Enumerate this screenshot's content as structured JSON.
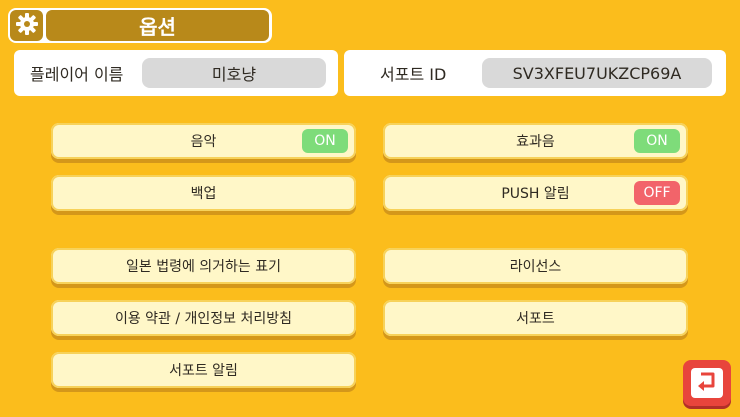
{
  "header": {
    "title": "옵션",
    "settings_icon": "gear-icon"
  },
  "info": {
    "player_name_label": "플레이어 이름",
    "player_name_value": "미호냥",
    "support_id_label": "서포트 ID",
    "support_id_value": "SV3XFEU7UKZCP69A"
  },
  "options": {
    "music": {
      "label": "음악",
      "state": "ON"
    },
    "sound_effects": {
      "label": "효과음",
      "state": "ON"
    },
    "backup": {
      "label": "백업"
    },
    "push": {
      "label": "PUSH 알림",
      "state": "OFF"
    },
    "legal_notice": {
      "label": "일본 법령에 의거하는 표기"
    },
    "license": {
      "label": "라이선스"
    },
    "terms": {
      "label": "이용 약관 / 개인정보 처리방침"
    },
    "support": {
      "label": "서포트"
    },
    "support_notice": {
      "label": "서포트 알림"
    }
  },
  "colors": {
    "background": "#fbbd1c",
    "header_bar": "#b8891a",
    "button_face": "#fff7c8",
    "toggle_on": "#7edc7a",
    "toggle_off": "#f2646a",
    "back_button": "#e8453c"
  },
  "back_icon": "return-arrow-icon"
}
